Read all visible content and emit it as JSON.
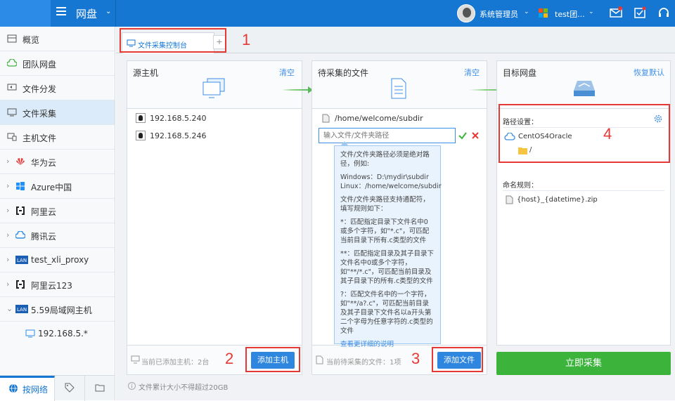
{
  "topbar": {
    "app_title": "网盘",
    "user_name": "系统管理员",
    "org_name": "test团...",
    "colors": {
      "bar": "#1677d2"
    }
  },
  "sidebar": {
    "items": [
      {
        "label": "概览",
        "icon": "grid-icon"
      },
      {
        "label": "团队网盘",
        "icon": "cloud-icon"
      },
      {
        "label": "文件分发",
        "icon": "share-icon"
      },
      {
        "label": "文件采集",
        "icon": "collect-icon"
      },
      {
        "label": "主机文件",
        "icon": "monitor-icon"
      },
      {
        "label": "华为云",
        "icon": "huawei-icon"
      },
      {
        "label": "Azure中国",
        "icon": "windows-icon"
      },
      {
        "label": "阿里云",
        "icon": "aliyun-icon"
      },
      {
        "label": "腾讯云",
        "icon": "tencent-icon"
      },
      {
        "label": "test_xli_proxy",
        "icon": "lan-icon"
      },
      {
        "label": "阿里云123",
        "icon": "aliyun-icon"
      },
      {
        "label": "5.59局域网主机",
        "icon": "lan-icon"
      },
      {
        "label": "192.168.5.*",
        "icon": "monitor-icon"
      }
    ],
    "bottom_tab": "按网络"
  },
  "tabs": {
    "active_label": "文件采集控制台"
  },
  "annotations": [
    "1",
    "2",
    "3",
    "4"
  ],
  "source": {
    "title": "源主机",
    "clear": "清空",
    "hosts": [
      "192.168.5.240",
      "192.168.5.246"
    ],
    "footer": "当前已添加主机：2台",
    "add_button": "添加主机"
  },
  "files": {
    "title": "待采集的文件",
    "clear": "清空",
    "path": "/home/welcome/subdir",
    "input_placeholder": "输入文件/文件夹路径",
    "footer": "当前待采集的文件：1项",
    "add_button": "添加文件",
    "tooltip": {
      "p1": "文件/文件夹路径必须是绝对路径，例如:",
      "p2a": "Windows：D:\\mydir\\subdir",
      "p2b": "Linux：/home/welcome/subdir",
      "p3": "文件/文件夹路径支持通配符，填写规则如下：",
      "p4": "*：匹配指定目录下文件名中0或多个字符，如\"*.c\"，可匹配当前目录下所有.c类型的文件",
      "p5": "**：匹配指定目录及其子目录下文件名中0或多个字符，如\"**/*.c\"，可匹配当前目录及其子目录下的所有.c类型的文件",
      "p6": "?：匹配文件名中的一个字符，如\"**/a?.c\"，可匹配当前目录及其子目录下文件名以a开头第二个字母为任意字符的.c类型的文件",
      "link": "查看更详细的说明"
    }
  },
  "target": {
    "title": "目标网盘",
    "reset": "恢复默认",
    "path_label": "路径设置：",
    "disk_name": "CentOS4Oracle",
    "folder": "/",
    "naming_label": "命名规则：",
    "naming_value": "{host}_{datetime}.zip",
    "start_button": "立即采集"
  },
  "note": "文件累计大小不得超过20GB"
}
